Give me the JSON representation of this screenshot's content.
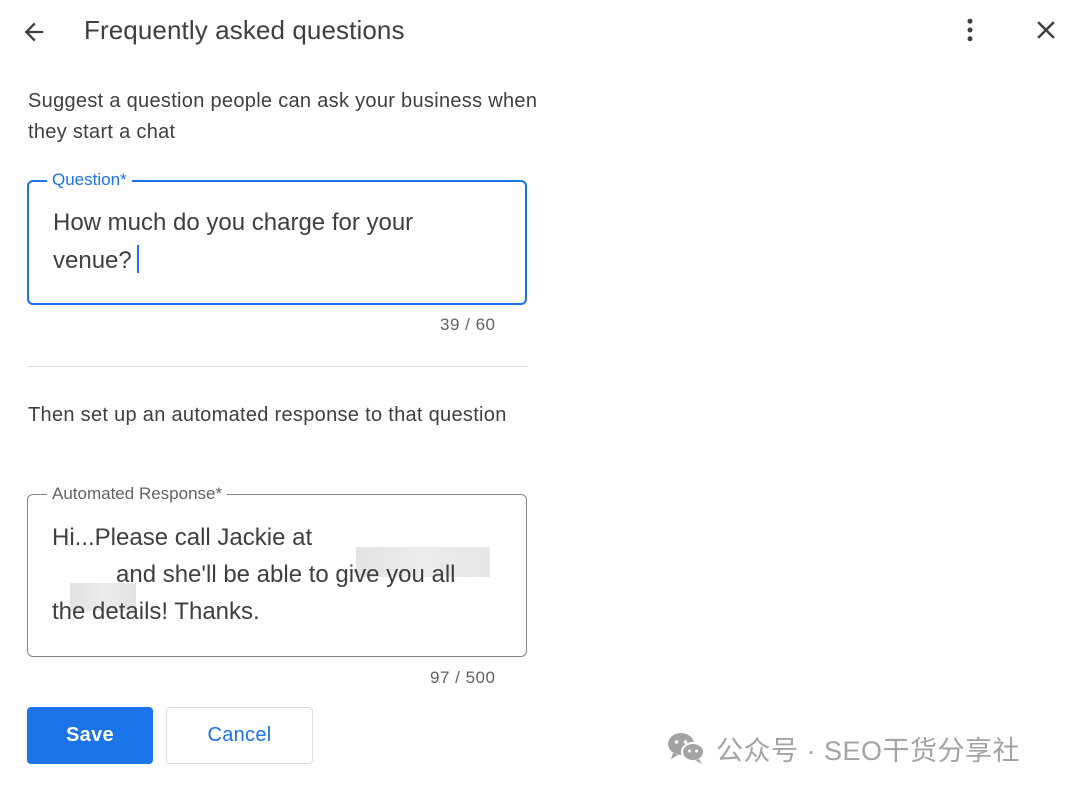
{
  "header": {
    "title": "Frequently asked questions",
    "back_icon": "arrow-left-icon",
    "more_icon": "more-vert-icon",
    "close_icon": "close-icon"
  },
  "question_section": {
    "helper_text": "Suggest a question people can ask your business when they start a chat",
    "field_label": "Question*",
    "value": "How much do you charge for your venue?",
    "counter": "39 / 60"
  },
  "response_section": {
    "helper_text": "Then set up an automated response to that question",
    "field_label": "Automated Response*",
    "value_part1": "Hi...Please call Jackie at",
    "value_part2": "and she'll be able to give you all",
    "value_part3": "the details! Thanks.",
    "counter": "97 / 500"
  },
  "actions": {
    "save_label": "Save",
    "cancel_label": "Cancel"
  },
  "watermark": {
    "text": "公众号 · SEO干货分享社",
    "icon": "wechat-logo-icon"
  },
  "colors": {
    "accent": "#1a73e8",
    "text_primary": "#3c4043",
    "text_secondary": "#5f6368",
    "divider": "#dadce0",
    "watermark": "#a3a3a3"
  }
}
